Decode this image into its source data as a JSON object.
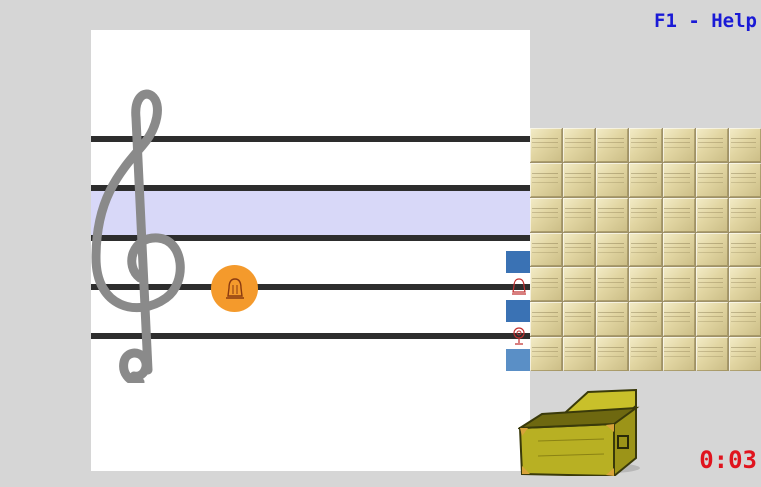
{
  "header": {
    "help_label": "F1 - Help"
  },
  "game": {
    "timer": "0:03",
    "clef": "treble-clef-icon",
    "note_symbol": "bell-icon",
    "staff_line_count": 5,
    "highlighted_space": 2,
    "tool_icons": [
      "blue-square-icon",
      "bell-icon",
      "blue-square-icon",
      "microphone-icon",
      "blue-square-icon"
    ],
    "puzzle_grid": {
      "columns": 7,
      "rows": 7
    }
  },
  "colors": {
    "background": "#d6d6d6",
    "staff": "#2d2d2d",
    "highlight": "#d8d8f8",
    "note": "#f49a2c",
    "help_text": "#1a1ad6",
    "timer_text": "#e0141e",
    "tile": "#e2d6a3"
  }
}
